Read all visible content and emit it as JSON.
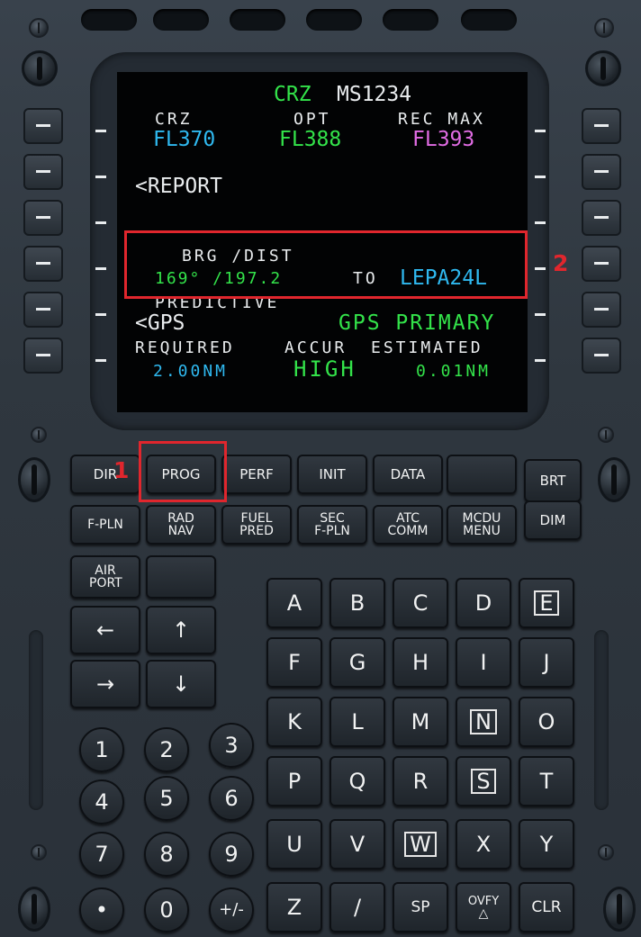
{
  "screen": {
    "title": {
      "prefix": "CRZ",
      "flight": "MS1234"
    },
    "headers": {
      "crz": "CRZ",
      "opt": "OPT",
      "rec_max": "REC MAX"
    },
    "levels": {
      "crz": "FL370",
      "opt": "FL388",
      "rec_max": "FL393"
    },
    "report": "<REPORT",
    "brg_dist_label": "BRG /DIST",
    "brg_dist_value": "169° /197.2",
    "to_label": "TO",
    "to_waypoint": "LEPA24L",
    "predictive_label": "PREDICTIVE",
    "gps_link": "<GPS",
    "gps_status": "GPS PRIMARY",
    "required_label": "REQUIRED",
    "accur_label": "ACCUR",
    "estimated_label": "ESTIMATED",
    "required_value": "2.00NM",
    "accur_value": "HIGH",
    "estimated_value": "0.01NM"
  },
  "annotations": {
    "prog_callout": "1",
    "brg_callout": "2"
  },
  "function_keys": {
    "row1": [
      "DIR",
      "PROG",
      "PERF",
      "INIT",
      "DATA",
      ""
    ],
    "row2": [
      "F-PLN",
      "RAD NAV",
      "FUEL PRED",
      "SEC F-PLN",
      "ATC COMM",
      "MCDU MENU"
    ],
    "brt": "BRT",
    "dim": "DIM",
    "airport": "AIR PORT",
    "arrow_left": "←",
    "arrow_up": "↑",
    "arrow_right": "→",
    "arrow_down": "↓"
  },
  "alpha_keys": [
    [
      "A",
      "B",
      "C",
      "D",
      "E"
    ],
    [
      "F",
      "G",
      "H",
      "I",
      "J"
    ],
    [
      "K",
      "L",
      "M",
      "N",
      "O"
    ],
    [
      "P",
      "Q",
      "R",
      "S",
      "T"
    ],
    [
      "U",
      "V",
      "W",
      "X",
      "Y"
    ],
    [
      "Z",
      "/",
      "SP",
      "OVFY",
      "CLR"
    ]
  ],
  "numeric_keys": [
    [
      "1",
      "2",
      "3"
    ],
    [
      "4",
      "5",
      "6"
    ],
    [
      "7",
      "8",
      "9"
    ],
    [
      "•",
      "0",
      "+/-"
    ]
  ],
  "colors": {
    "green": "#33e34a",
    "cyan": "#2fb9f0",
    "magenta": "#e16ce4",
    "white": "#e9ecee",
    "highlight": "#e0262d",
    "key_text": "#f0bfa5"
  }
}
